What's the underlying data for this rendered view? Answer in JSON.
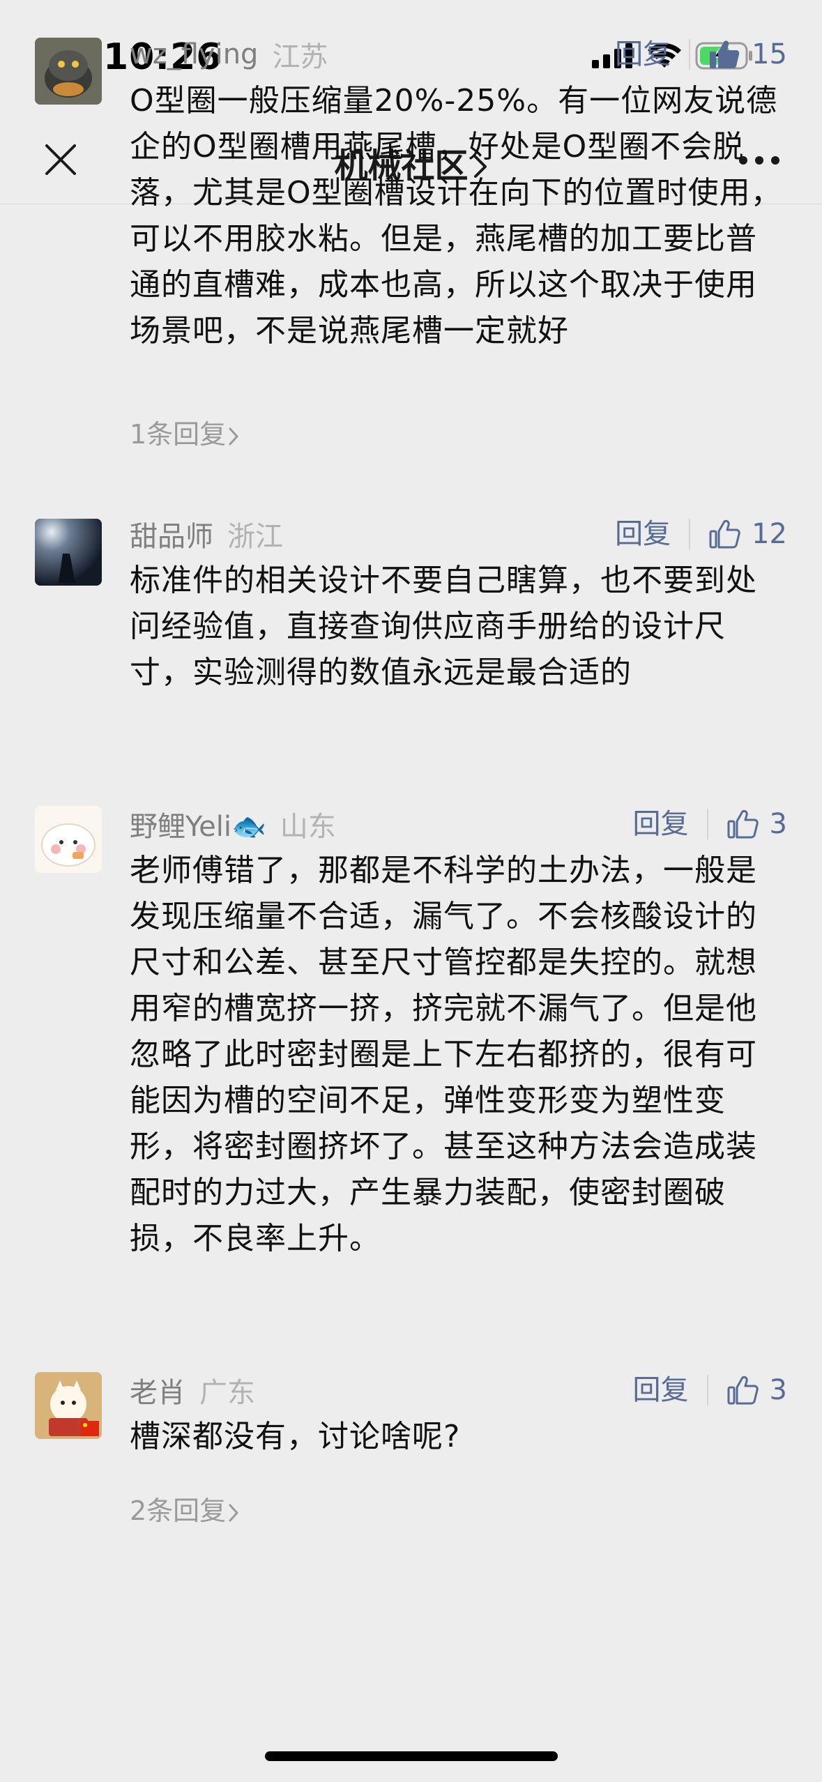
{
  "status": {
    "time": "10:26"
  },
  "nav": {
    "title": "机械社区",
    "close_icon": "close-icon",
    "more_icon": "more-icon"
  },
  "colors": {
    "background": "#ededed",
    "link": "#576b95",
    "name": "#7f7f7f",
    "region": "#b2b2b2",
    "battery_green": "#4cd964"
  },
  "comments": [
    {
      "name": "wz_flying",
      "region": "江苏",
      "reply_label": "回复",
      "likes": "15",
      "liked": true,
      "text": "O型圈一般压缩量20%-25%。有一位网友说德企的O型圈槽用燕尾槽，好处是O型圈不会脱落，尤其是O型圈槽设计在向下的位置时使用，可以不用胶水粘。但是，燕尾槽的加工要比普通的直槽难，成本也高，所以这个取决于使用场景吧，不是说燕尾槽一定就好",
      "more": "1条回复"
    },
    {
      "name": "甜品师",
      "region": "浙江",
      "reply_label": "回复",
      "likes": "12",
      "liked": false,
      "text": "标准件的相关设计不要自己瞎算，也不要到处问经验值，直接查询供应商手册给的设计尺寸，实验测得的数值永远是最合适的"
    },
    {
      "name": "野鲤Yeli🐟",
      "region": "山东",
      "reply_label": "回复",
      "likes": "3",
      "liked": false,
      "text": "老师傅错了，那都是不科学的土办法，一般是发现压缩量不合适，漏气了。不会核酸设计的尺寸和公差、甚至尺寸管控都是失控的。就想用窄的槽宽挤一挤，挤完就不漏气了。但是他忽略了此时密封圈是上下左右都挤的，很有可能因为槽的空间不足，弹性变形变为塑性变形，将密封圈挤坏了。甚至这种方法会造成装配时的力过大，产生暴力装配，使密封圈破损，不良率上升。"
    },
    {
      "name": "老肖",
      "region": "广东",
      "reply_label": "回复",
      "likes": "3",
      "liked": false,
      "text": "槽深都没有，讨论啥呢?",
      "more": "2条回复"
    }
  ]
}
